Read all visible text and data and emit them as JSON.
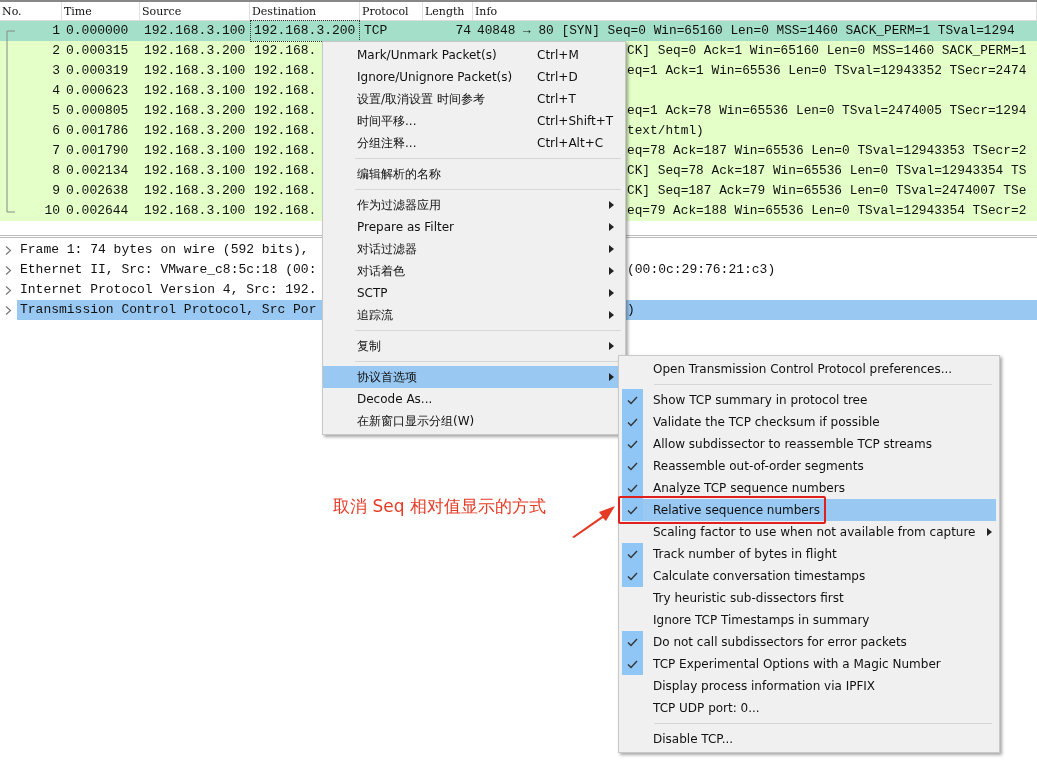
{
  "packet_list": {
    "columns": [
      "No.",
      "Time",
      "Source",
      "Destination",
      "Protocol",
      "Length",
      "Info"
    ],
    "rows": [
      {
        "no": "1",
        "time": "0.000000",
        "source": "192.168.3.100",
        "destination": "192.168.3.200",
        "protocol": "TCP",
        "length": "74",
        "info": "40848 → 80 [SYN] Seq=0 Win=65160 Len=0 MSS=1460 SACK_PERM=1 TSval=1294",
        "selected": true
      },
      {
        "no": "2",
        "time": "0.000315",
        "source": "192.168.3.200",
        "destination": "192.168.",
        "info": "CK] Seq=0 Ack=1 Win=65160 Len=0 MSS=1460 SACK_PERM=1",
        "selected": false
      },
      {
        "no": "3",
        "time": "0.000319",
        "source": "192.168.3.100",
        "destination": "192.168.",
        "info": "eq=1 Ack=1 Win=65536 Len=0 TSval=12943352 TSecr=2474",
        "selected": false
      },
      {
        "no": "4",
        "time": "0.000623",
        "source": "192.168.3.100",
        "destination": "192.168.",
        "selected": false
      },
      {
        "no": "5",
        "time": "0.000805",
        "source": "192.168.3.200",
        "destination": "192.168.",
        "info": "eq=1 Ack=78 Win=65536 Len=0 TSval=2474005 TSecr=1294",
        "selected": false
      },
      {
        "no": "6",
        "time": "0.001786",
        "source": "192.168.3.200",
        "destination": "192.168.",
        "info": "text/html)",
        "selected": false
      },
      {
        "no": "7",
        "time": "0.001790",
        "source": "192.168.3.100",
        "destination": "192.168.",
        "info": "eq=78 Ack=187 Win=65536 Len=0 TSval=12943353 TSecr=2",
        "selected": false
      },
      {
        "no": "8",
        "time": "0.002134",
        "source": "192.168.3.100",
        "destination": "192.168.",
        "info": "CK] Seq=78 Ack=187 Win=65536 Len=0 TSval=12943354 TS",
        "selected": false
      },
      {
        "no": "9",
        "time": "0.002638",
        "source": "192.168.3.200",
        "destination": "192.168.",
        "info": "CK] Seq=187 Ack=79 Win=65536 Len=0 TSval=2474007 TSe",
        "selected": false
      },
      {
        "no": "10",
        "time": "0.002644",
        "source": "192.168.3.100",
        "destination": "192.168.",
        "info": "eq=79 Ack=188 Win=65536 Len=0 TSval=12943354 TSecr=2",
        "selected": false
      }
    ]
  },
  "detail_tree": [
    {
      "label": "Frame 1: 74 bytes on wire (592 bits),",
      "expanded": false,
      "selected": false
    },
    {
      "label": "Ethernet II, Src: VMware_c8:5c:18 (00:",
      "label_right": "(00:0c:29:76:21:c3)",
      "expanded": false,
      "selected": false
    },
    {
      "label": "Internet Protocol Version 4, Src: 192.",
      "expanded": false,
      "selected": false
    },
    {
      "label": "Transmission Control Protocol, Src Por",
      "label_right": ")",
      "expanded": false,
      "selected": true
    }
  ],
  "context_menu": {
    "groups": [
      [
        {
          "label": "Mark/Unmark Packet(s)",
          "shortcut": "Ctrl+M",
          "has_submenu": false,
          "selected": false
        },
        {
          "label": "Ignore/Unignore Packet(s)",
          "shortcut": "Ctrl+D",
          "has_submenu": false,
          "selected": false
        },
        {
          "label": "设置/取消设置 时间参考",
          "shortcut": "Ctrl+T",
          "has_submenu": false,
          "selected": false
        },
        {
          "label": "时间平移...",
          "shortcut": "Ctrl+Shift+T",
          "has_submenu": false,
          "selected": false
        },
        {
          "label": "分组注释...",
          "shortcut": "Ctrl+Alt+C",
          "has_submenu": false,
          "selected": false
        }
      ],
      [
        {
          "label": "编辑解析的名称",
          "has_submenu": false,
          "selected": false
        }
      ],
      [
        {
          "label": "作为过滤器应用",
          "has_submenu": true,
          "selected": false
        },
        {
          "label": "Prepare as Filter",
          "has_submenu": true,
          "selected": false
        },
        {
          "label": "对话过滤器",
          "has_submenu": true,
          "selected": false
        },
        {
          "label": "对话着色",
          "has_submenu": true,
          "selected": false
        },
        {
          "label": "SCTP",
          "has_submenu": true,
          "selected": false
        },
        {
          "label": "追踪流",
          "has_submenu": true,
          "selected": false
        }
      ],
      [
        {
          "label": "复制",
          "has_submenu": true,
          "selected": false
        }
      ],
      [
        {
          "label": "协议首选项",
          "has_submenu": true,
          "selected": true
        },
        {
          "label": "Decode As...",
          "has_submenu": false,
          "selected": false
        },
        {
          "label": "在新窗口显示分组(W)",
          "has_submenu": false,
          "selected": false
        }
      ]
    ]
  },
  "submenu": {
    "groups": [
      [
        {
          "label": "Open Transmission Control Protocol preferences...",
          "checked": false,
          "has_submenu": false,
          "selected": false,
          "annotated": false
        }
      ],
      [
        {
          "label": "Show TCP summary in protocol tree",
          "checked": true,
          "has_submenu": false,
          "selected": false,
          "annotated": false
        },
        {
          "label": "Validate the TCP checksum if possible",
          "checked": true,
          "has_submenu": false,
          "selected": false,
          "annotated": false
        },
        {
          "label": "Allow subdissector to reassemble TCP streams",
          "checked": true,
          "has_submenu": false,
          "selected": false,
          "annotated": false
        },
        {
          "label": "Reassemble out-of-order segments",
          "checked": true,
          "has_submenu": false,
          "selected": false,
          "annotated": false
        },
        {
          "label": "Analyze TCP sequence numbers",
          "checked": true,
          "has_submenu": false,
          "selected": false,
          "annotated": false
        },
        {
          "label": "Relative sequence numbers",
          "checked": true,
          "has_submenu": false,
          "selected": true,
          "annotated": true
        },
        {
          "label": "Scaling factor to use when not available from capture",
          "checked": false,
          "has_submenu": true,
          "selected": false,
          "annotated": false
        },
        {
          "label": "Track number of bytes in flight",
          "checked": true,
          "has_submenu": false,
          "selected": false,
          "annotated": false
        },
        {
          "label": "Calculate conversation timestamps",
          "checked": true,
          "has_submenu": false,
          "selected": false,
          "annotated": false
        },
        {
          "label": "Try heuristic sub-dissectors first",
          "checked": false,
          "has_submenu": false,
          "selected": false,
          "annotated": false
        },
        {
          "label": "Ignore TCP Timestamps in summary",
          "checked": false,
          "has_submenu": false,
          "selected": false,
          "annotated": false
        },
        {
          "label": "Do not call subdissectors for error packets",
          "checked": true,
          "has_submenu": false,
          "selected": false,
          "annotated": false
        },
        {
          "label": "TCP Experimental Options with a Magic Number",
          "checked": true,
          "has_submenu": false,
          "selected": false,
          "annotated": false
        },
        {
          "label": "Display process information via IPFIX",
          "checked": false,
          "has_submenu": false,
          "selected": false,
          "annotated": false
        },
        {
          "label": "TCP UDP port: 0...",
          "checked": false,
          "has_submenu": false,
          "selected": false,
          "annotated": false
        }
      ],
      [
        {
          "label": "Disable TCP...",
          "checked": false,
          "has_submenu": false,
          "selected": false,
          "annotated": false
        }
      ]
    ]
  },
  "annotation": {
    "text": "取消 Seq 相对值显示的方式"
  }
}
